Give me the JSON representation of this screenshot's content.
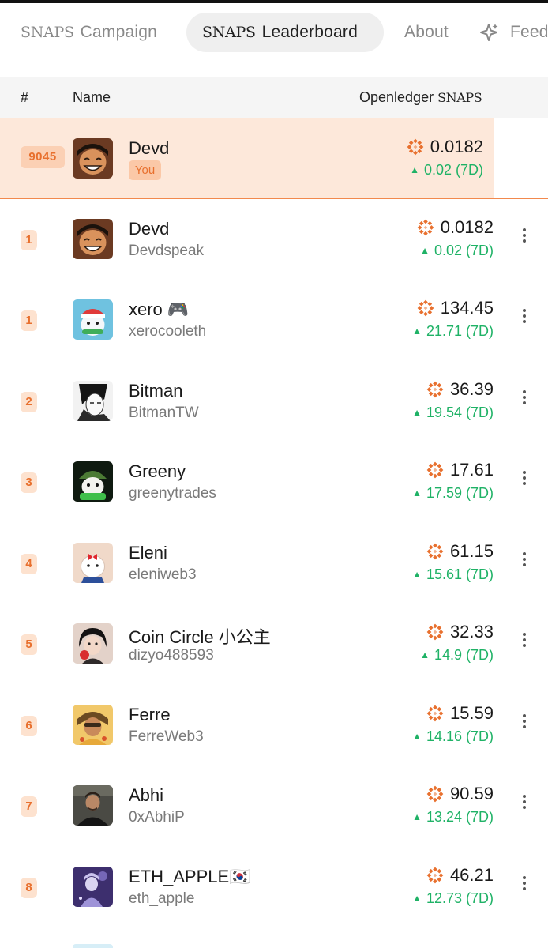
{
  "nav": {
    "tabs": [
      {
        "snaps": "SNAPS",
        "label": "Campaign"
      },
      {
        "snaps": "SNAPS",
        "label": "Leaderboard"
      },
      {
        "label": "About"
      },
      {
        "label": "Feed"
      }
    ]
  },
  "table": {
    "headers": {
      "rank": "#",
      "name": "Name",
      "snaps_prefix": "Openledger",
      "snaps_word": "SNAPS"
    }
  },
  "me": {
    "rank": "9045",
    "name": "Devd",
    "badge": "You",
    "score": "0.0182",
    "delta": "0.02 (7D)"
  },
  "rows": [
    {
      "rank": "1",
      "name": "Devd",
      "handle": "Devdspeak",
      "score": "0.0182",
      "delta": "0.02 (7D)"
    },
    {
      "rank": "1",
      "name": "xero 🎮",
      "handle": "xerocooleth",
      "score": "134.45",
      "delta": "21.71 (7D)"
    },
    {
      "rank": "2",
      "name": "Bitman",
      "handle": "BitmanTW",
      "score": "36.39",
      "delta": "19.54 (7D)"
    },
    {
      "rank": "3",
      "name": "Greeny",
      "handle": "greenytrades",
      "score": "17.61",
      "delta": "17.59 (7D)"
    },
    {
      "rank": "4",
      "name": "Eleni",
      "handle": "eleniweb3",
      "score": "61.15",
      "delta": "15.61 (7D)"
    },
    {
      "rank": "5",
      "name": "Coin Circle 小公主",
      "handle": "dizyo488593",
      "score": "32.33",
      "delta": "14.9 (7D)"
    },
    {
      "rank": "6",
      "name": "Ferre",
      "handle": "FerreWeb3",
      "score": "15.59",
      "delta": "14.16 (7D)"
    },
    {
      "rank": "7",
      "name": "Abhi",
      "handle": "0xAbhiP",
      "score": "90.59",
      "delta": "13.24 (7D)"
    },
    {
      "rank": "8",
      "name": "ETH_APPLE🇰🇷",
      "handle": "eth_apple",
      "score": "46.21",
      "delta": "12.73 (7D)"
    }
  ],
  "colors": {
    "accent": "#e8702e",
    "positive": "#1fb266",
    "highlight": "#fde8da"
  },
  "icons": {
    "snaps": "snaps-burst-icon",
    "delta": "up-triangle-icon",
    "menu": "kebab-icon",
    "feed": "sparkle-icon"
  }
}
